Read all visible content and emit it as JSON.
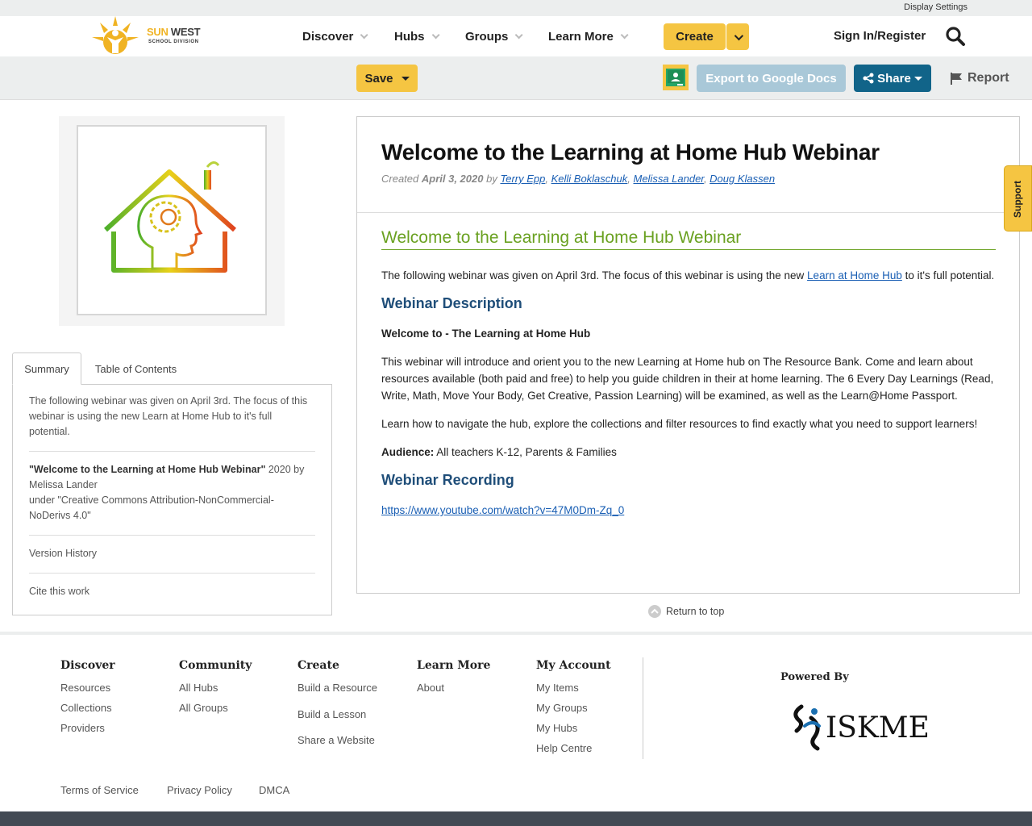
{
  "top_bar": {
    "display_settings": "Display Settings"
  },
  "logo": {
    "word1": "SUN",
    "word2": "WEST",
    "subtitle": "SCHOOL DIVISION"
  },
  "nav": {
    "items": [
      {
        "label": "Discover"
      },
      {
        "label": "Hubs"
      },
      {
        "label": "Groups"
      },
      {
        "label": "Learn More"
      }
    ],
    "create_label": "Create",
    "signin_label": "Sign In/Register"
  },
  "toolbar": {
    "save_label": "Save",
    "export_label": "Export to Google Docs",
    "share_label": "Share",
    "report_label": "Report"
  },
  "tabs": {
    "summary": "Summary",
    "toc": "Table of Contents"
  },
  "summary": {
    "description": "The following webinar was given on April 3rd. The focus of this webinar is using the new Learn at Home Hub to it's full potential.",
    "attribution_title": "\"Welcome to the Learning at Home Hub Webinar\"",
    "attribution_year_by": " 2020 by",
    "attribution_author": "Melissa Lander",
    "attribution_license": "under \"Creative Commons Attribution-NonCommercial-NoDerivs 4.0\"",
    "version_history": "Version History",
    "cite": "Cite this work"
  },
  "resource": {
    "title": "Welcome to the Learning at Home Hub Webinar",
    "created_prefix": "Created",
    "created_date": "April 3, 2020",
    "by": "by",
    "authors": [
      "Terry Epp",
      "Kelli Boklaschuk",
      "Melissa Lander",
      "Doug Klassen"
    ],
    "heading": "Welcome to the Learning at Home Hub Webinar",
    "intro_before": "The following webinar was given on April 3rd.  The focus of this webinar is using the new ",
    "intro_link": "Learn at Home Hub",
    "intro_after": " to it's full potential.",
    "desc_heading": "Webinar Description",
    "welcome_line": "Welcome to - The Learning at Home Hub",
    "para1": "This webinar will introduce and orient you to the new Learning at Home hub on The Resource Bank.  Come and learn about resources available (both paid and free) to help you guide children in their at home learning. The 6 Every Day Learnings (Read, Write, Math, Move Your Body, Get Creative, Passion Learning) will be examined, as well as the Learn@Home Passport.",
    "para2": "Learn how to navigate the hub, explore the collections and filter resources to find exactly what you need to support learners!",
    "audience_label": "Audience:",
    "audience_value": " All teachers K-12, Parents & Families",
    "rec_heading": "Webinar Recording",
    "rec_link": "https://www.youtube.com/watch?v=47M0Dm-Zq_0"
  },
  "return_to_top": "Return to top",
  "support_label": "Support",
  "footer": {
    "discover": {
      "heading": "Discover",
      "links": [
        "Resources",
        "Collections",
        "Providers"
      ]
    },
    "community": {
      "heading": "Community",
      "links": [
        "All Hubs",
        "All Groups"
      ]
    },
    "create": {
      "heading": "Create",
      "links": [
        "Build a Resource",
        "Build a Lesson",
        "Share a Website"
      ]
    },
    "learn_more": {
      "heading": "Learn More",
      "links": [
        "About"
      ]
    },
    "my_account": {
      "heading": "My Account",
      "links": [
        "My Items",
        "My Groups",
        "My Hubs",
        "Help Centre"
      ]
    },
    "powered_by": "Powered By",
    "iskme": "ISKME",
    "legal": [
      "Terms of Service",
      "Privacy Policy",
      "DMCA"
    ]
  },
  "colors": {
    "accent_yellow": "#f5c542",
    "share_blue": "#116489",
    "heading_green": "#6aa121",
    "subheading_navy": "#1f4e79"
  }
}
